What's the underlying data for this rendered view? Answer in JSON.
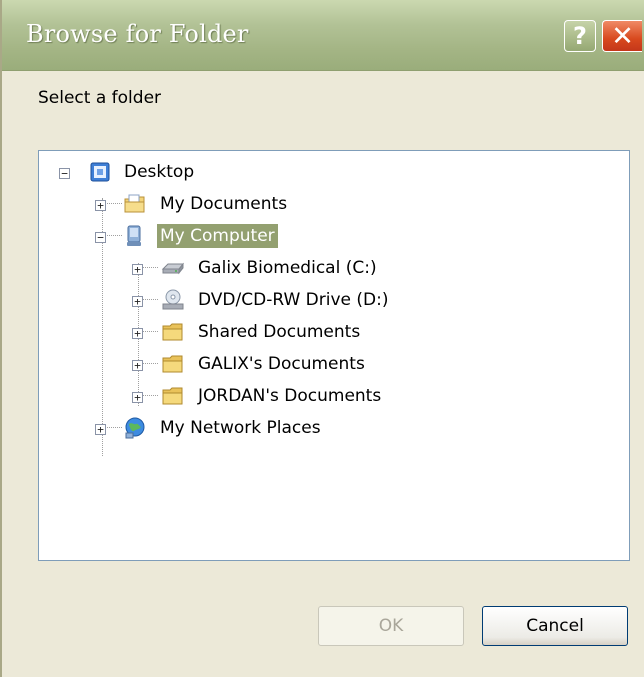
{
  "window": {
    "title": "Browse for Folder",
    "help_symbol": "?",
    "close_symbol": "✕"
  },
  "prompt": "Select a folder",
  "tree": {
    "nodes": [
      {
        "label": "Desktop",
        "icon": "desktop-icon",
        "expander": "−",
        "level": 0
      },
      {
        "label": "My Documents",
        "icon": "my-documents-icon",
        "expander": "+",
        "level": 1
      },
      {
        "label": "My Computer",
        "icon": "my-computer-icon",
        "expander": "−",
        "level": 1,
        "selected": true
      },
      {
        "label": "Galix Biomedical (C:)",
        "icon": "hard-drive-icon",
        "expander": "+",
        "level": 2
      },
      {
        "label": "DVD/CD-RW Drive (D:)",
        "icon": "dvd-drive-icon",
        "expander": "+",
        "level": 2
      },
      {
        "label": "Shared Documents",
        "icon": "folder-icon",
        "expander": "+",
        "level": 2
      },
      {
        "label": "GALIX's Documents",
        "icon": "folder-icon",
        "expander": "+",
        "level": 2
      },
      {
        "label": "JORDAN's Documents",
        "icon": "folder-icon",
        "expander": "+",
        "level": 2
      },
      {
        "label": "My Network Places",
        "icon": "network-places-icon",
        "expander": "+",
        "level": 1
      }
    ]
  },
  "buttons": {
    "ok": "OK",
    "cancel": "Cancel"
  },
  "colors": {
    "titlebar": "#a4b585",
    "selection": "#93a070",
    "close": "#d8491e"
  }
}
